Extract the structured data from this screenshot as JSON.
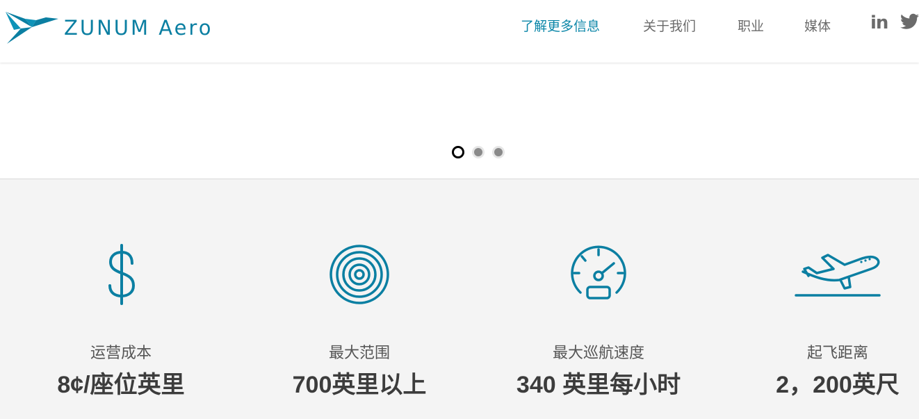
{
  "header": {
    "logo_text": "ZUNUM Aero",
    "nav": [
      {
        "label": "了解更多信息",
        "active": true
      },
      {
        "label": "关于我们",
        "active": false
      },
      {
        "label": "职业",
        "active": false
      },
      {
        "label": "媒体",
        "active": false
      }
    ],
    "social": [
      "linkedin-icon",
      "twitter-icon"
    ],
    "social_labels": {
      "linkedin": "in"
    }
  },
  "carousel": {
    "slides": 3,
    "active_slide": 1
  },
  "stats": [
    {
      "icon": "dollar-icon",
      "label": "运营成本",
      "value": "8¢/座位英里"
    },
    {
      "icon": "target-icon",
      "label": "最大范围",
      "value": "700英里以上"
    },
    {
      "icon": "speedometer-icon",
      "label": "最大巡航速度",
      "value": "340 英里每小时"
    },
    {
      "icon": "airplane-takeoff-icon",
      "label": "起飞距离",
      "value": "2，200英尺"
    }
  ],
  "colors": {
    "brand": "#0b7fa2",
    "nav_active": "#0b86a8",
    "nav_text": "#6b6b6b",
    "stats_bg": "#f4f4f4",
    "stat_value": "#3c3c3c"
  }
}
